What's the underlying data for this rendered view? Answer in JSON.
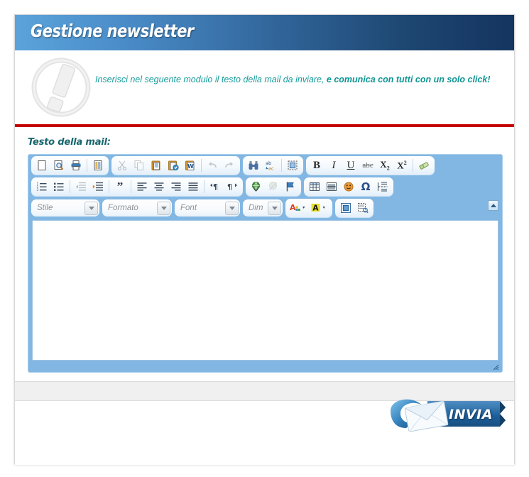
{
  "header": {
    "title": "Gestione newsletter",
    "gradient_from": "#5ba3da",
    "gradient_to": "#143560"
  },
  "intro": {
    "logo_icon": "exclamation-circle-icon",
    "text_normal": "Inserisci nel seguente modulo il testo della mail da inviare,",
    "text_strong": "e comunica con tutti con un solo click!",
    "text_color": "#169b9b",
    "divider_color": "#c40000"
  },
  "form": {
    "field_label": "Testo della mail:"
  },
  "editor": {
    "toolbar_bg": "#82b7e3",
    "collapse_icon": "toolbar-collapse-icon",
    "content_value": "",
    "resize_grip_icon": "resize-grip-icon",
    "rows": [
      {
        "groups": [
          {
            "name": "document",
            "buttons": [
              {
                "name": "new-page-button",
                "icon": "new-page-icon",
                "label": "Nuova pagina",
                "disabled": false
              },
              {
                "name": "preview-button",
                "icon": "preview-icon",
                "label": "Anteprima",
                "disabled": false
              },
              {
                "name": "print-button",
                "icon": "print-icon",
                "label": "Stampa",
                "disabled": false
              },
              {
                "name": "separator",
                "icon": "separator",
                "label": "",
                "disabled": false
              },
              {
                "name": "templates-button",
                "icon": "templates-icon",
                "label": "Modelli",
                "disabled": false
              }
            ]
          },
          {
            "name": "clipboard",
            "buttons": [
              {
                "name": "cut-button",
                "icon": "scissors-icon",
                "label": "Taglia",
                "disabled": true
              },
              {
                "name": "copy-button",
                "icon": "copy-icon",
                "label": "Copia",
                "disabled": true
              },
              {
                "name": "paste-button",
                "icon": "paste-icon",
                "label": "Incolla",
                "disabled": false
              },
              {
                "name": "paste-text-button",
                "icon": "paste-text-icon",
                "label": "Incolla come testo semplice",
                "disabled": false
              },
              {
                "name": "paste-word-button",
                "icon": "paste-word-icon",
                "label": "Incolla da Word",
                "disabled": false
              },
              {
                "name": "separator",
                "icon": "separator",
                "label": "",
                "disabled": false
              },
              {
                "name": "undo-button",
                "icon": "undo-arrow-icon",
                "label": "Annulla",
                "disabled": true
              },
              {
                "name": "redo-button",
                "icon": "redo-arrow-icon",
                "label": "Ripristina",
                "disabled": true
              }
            ]
          },
          {
            "name": "editing",
            "buttons": [
              {
                "name": "find-button",
                "icon": "binoculars-icon",
                "label": "Trova",
                "disabled": false
              },
              {
                "name": "replace-button",
                "icon": "replace-icon",
                "label": "Sostituisci",
                "disabled": false
              },
              {
                "name": "separator",
                "icon": "separator",
                "label": "",
                "disabled": false
              },
              {
                "name": "select-all-button",
                "icon": "select-all-icon",
                "label": "Seleziona tutto",
                "disabled": false
              }
            ]
          },
          {
            "name": "basic-styles",
            "buttons": [
              {
                "name": "bold-button",
                "icon": "bold-icon",
                "label": "Grassetto",
                "disabled": false
              },
              {
                "name": "italic-button",
                "icon": "italic-icon",
                "label": "Corsivo",
                "disabled": false
              },
              {
                "name": "underline-button",
                "icon": "underline-icon",
                "label": "Sottolineato",
                "disabled": false
              },
              {
                "name": "strike-button",
                "icon": "strikethrough-icon",
                "label": "Barrato",
                "disabled": false
              },
              {
                "name": "subscript-button",
                "icon": "subscript-icon",
                "label": "Pedice",
                "disabled": false
              },
              {
                "name": "superscript-button",
                "icon": "superscript-icon",
                "label": "Apice",
                "disabled": false
              },
              {
                "name": "separator",
                "icon": "separator",
                "label": "",
                "disabled": false
              },
              {
                "name": "remove-format-button",
                "icon": "eraser-icon",
                "label": "Elimina formattazione",
                "disabled": false
              }
            ]
          }
        ]
      },
      {
        "groups": [
          {
            "name": "paragraph",
            "buttons": [
              {
                "name": "numbered-list-button",
                "icon": "numbered-list-icon",
                "label": "Elenco numerato",
                "disabled": false
              },
              {
                "name": "bulleted-list-button",
                "icon": "bulleted-list-icon",
                "label": "Elenco puntato",
                "disabled": false
              },
              {
                "name": "separator",
                "icon": "separator",
                "label": "",
                "disabled": false
              },
              {
                "name": "outdent-button",
                "icon": "decrease-indent-icon",
                "label": "Riduci rientro",
                "disabled": true
              },
              {
                "name": "indent-button",
                "icon": "increase-indent-icon",
                "label": "Aumenta rientro",
                "disabled": false
              },
              {
                "name": "separator",
                "icon": "separator",
                "label": "",
                "disabled": false
              },
              {
                "name": "blockquote-button",
                "icon": "quote-icon",
                "label": "Citazione",
                "disabled": false
              },
              {
                "name": "separator",
                "icon": "separator",
                "label": "",
                "disabled": false
              },
              {
                "name": "align-left-button",
                "icon": "align-left-icon",
                "label": "Allinea a sinistra",
                "disabled": false
              },
              {
                "name": "align-center-button",
                "icon": "align-center-icon",
                "label": "Centra",
                "disabled": false
              },
              {
                "name": "align-right-button",
                "icon": "align-right-icon",
                "label": "Allinea a destra",
                "disabled": false
              },
              {
                "name": "justify-button",
                "icon": "justify-icon",
                "label": "Giustifica",
                "disabled": false
              },
              {
                "name": "separator",
                "icon": "separator",
                "label": "",
                "disabled": false
              },
              {
                "name": "ltr-button",
                "icon": "text-direction-ltr-icon",
                "label": "Da sinistra a destra",
                "disabled": false
              },
              {
                "name": "rtl-button",
                "icon": "text-direction-rtl-icon",
                "label": "Da destra a sinistra",
                "disabled": false
              }
            ]
          },
          {
            "name": "links",
            "buttons": [
              {
                "name": "link-button",
                "icon": "globe-link-icon",
                "label": "Inserisci collegamento",
                "disabled": false
              },
              {
                "name": "unlink-button",
                "icon": "unlink-icon",
                "label": "Elimina collegamento",
                "disabled": true
              },
              {
                "name": "anchor-button",
                "icon": "flag-anchor-icon",
                "label": "Ancora",
                "disabled": false
              }
            ]
          },
          {
            "name": "insert",
            "buttons": [
              {
                "name": "table-button",
                "icon": "table-icon",
                "label": "Tabella",
                "disabled": false
              },
              {
                "name": "horizontal-rule-button",
                "icon": "horizontal-rule-icon",
                "label": "Linea orizzontale",
                "disabled": false
              },
              {
                "name": "smiley-button",
                "icon": "smiley-icon",
                "label": "Emoticon",
                "disabled": false
              },
              {
                "name": "special-char-button",
                "icon": "omega-icon",
                "label": "Caratteri speciali",
                "disabled": false
              },
              {
                "name": "page-break-button",
                "icon": "page-break-icon",
                "label": "Interruzione di pagina",
                "disabled": false
              }
            ]
          }
        ]
      }
    ],
    "combos": [
      {
        "name": "style-select",
        "label": "Stile",
        "class": "c-stile"
      },
      {
        "name": "format-select",
        "label": "Formato",
        "class": "c-formato"
      },
      {
        "name": "font-select",
        "label": "Font",
        "class": "c-font"
      },
      {
        "name": "size-select",
        "label": "Dim",
        "class": "c-dim"
      }
    ],
    "color_buttons": [
      {
        "name": "text-color-button",
        "icon": "text-color-icon",
        "label": "Colore testo"
      },
      {
        "name": "bg-color-button",
        "icon": "background-color-icon",
        "label": "Colore sfondo"
      }
    ],
    "tool_buttons": [
      {
        "name": "maximize-button",
        "icon": "maximize-icon",
        "label": "Massimizza"
      },
      {
        "name": "show-blocks-button",
        "icon": "show-blocks-icon",
        "label": "Mostra blocchi"
      }
    ]
  },
  "submit": {
    "button_label": "INVIA",
    "button_icon": "envelope-send-icon",
    "button_color": "#1f5f9e"
  }
}
